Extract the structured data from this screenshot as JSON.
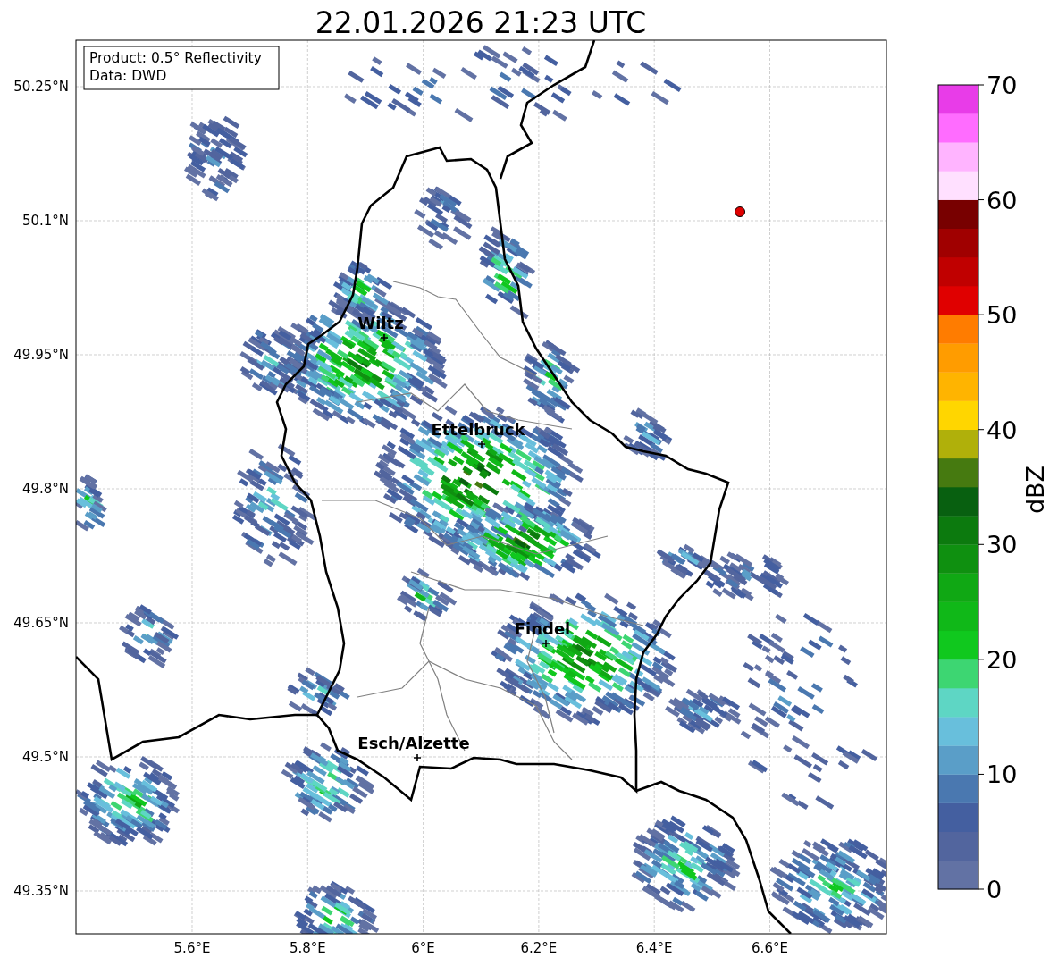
{
  "title": "22.01.2026 21:23 UTC",
  "info_box": {
    "lines": [
      "Product: 0.5° Reflectivity",
      "Data: DWD"
    ]
  },
  "map": {
    "lat_ticks": [
      "50.25°N",
      "50.1°N",
      "49.95°N",
      "49.8°N",
      "49.65°N",
      "49.5°N",
      "49.35°N"
    ],
    "lon_ticks": [
      "5.6°E",
      "5.8°E",
      "6°E",
      "6.2°E",
      "6.4°E",
      "6.6°E"
    ],
    "cities": [
      {
        "name": "Wiltz"
      },
      {
        "name": "Ettelbruck"
      },
      {
        "name": "Findel"
      },
      {
        "name": "Esch/Alzette"
      }
    ]
  },
  "colorbar": {
    "label": "dBZ",
    "ticks": [
      "70",
      "60",
      "50",
      "40",
      "30",
      "20",
      "10",
      "0"
    ],
    "bins": [
      {
        "color": "#6272a4"
      },
      {
        "color": "#52659e"
      },
      {
        "color": "#445fa0"
      },
      {
        "color": "#4a78b0"
      },
      {
        "color": "#5a9ec8"
      },
      {
        "color": "#68bfdc"
      },
      {
        "color": "#5ed6c4"
      },
      {
        "color": "#3dd672"
      },
      {
        "color": "#10c81e"
      },
      {
        "color": "#10b818"
      },
      {
        "color": "#10a814"
      },
      {
        "color": "#0f9010"
      },
      {
        "color": "#0c7a0e"
      },
      {
        "color": "#086010"
      },
      {
        "color": "#467a10"
      },
      {
        "color": "#b0b00a"
      },
      {
        "color": "#ffd600"
      },
      {
        "color": "#ffb400"
      },
      {
        "color": "#ff9c00"
      },
      {
        "color": "#ff7c00"
      },
      {
        "color": "#e00000"
      },
      {
        "color": "#c00000"
      },
      {
        "color": "#a00000"
      },
      {
        "color": "#780000"
      },
      {
        "color": "#ffe0ff"
      },
      {
        "color": "#ffb4ff"
      },
      {
        "color": "#ff6cff"
      },
      {
        "color": "#e83ce8"
      }
    ]
  }
}
